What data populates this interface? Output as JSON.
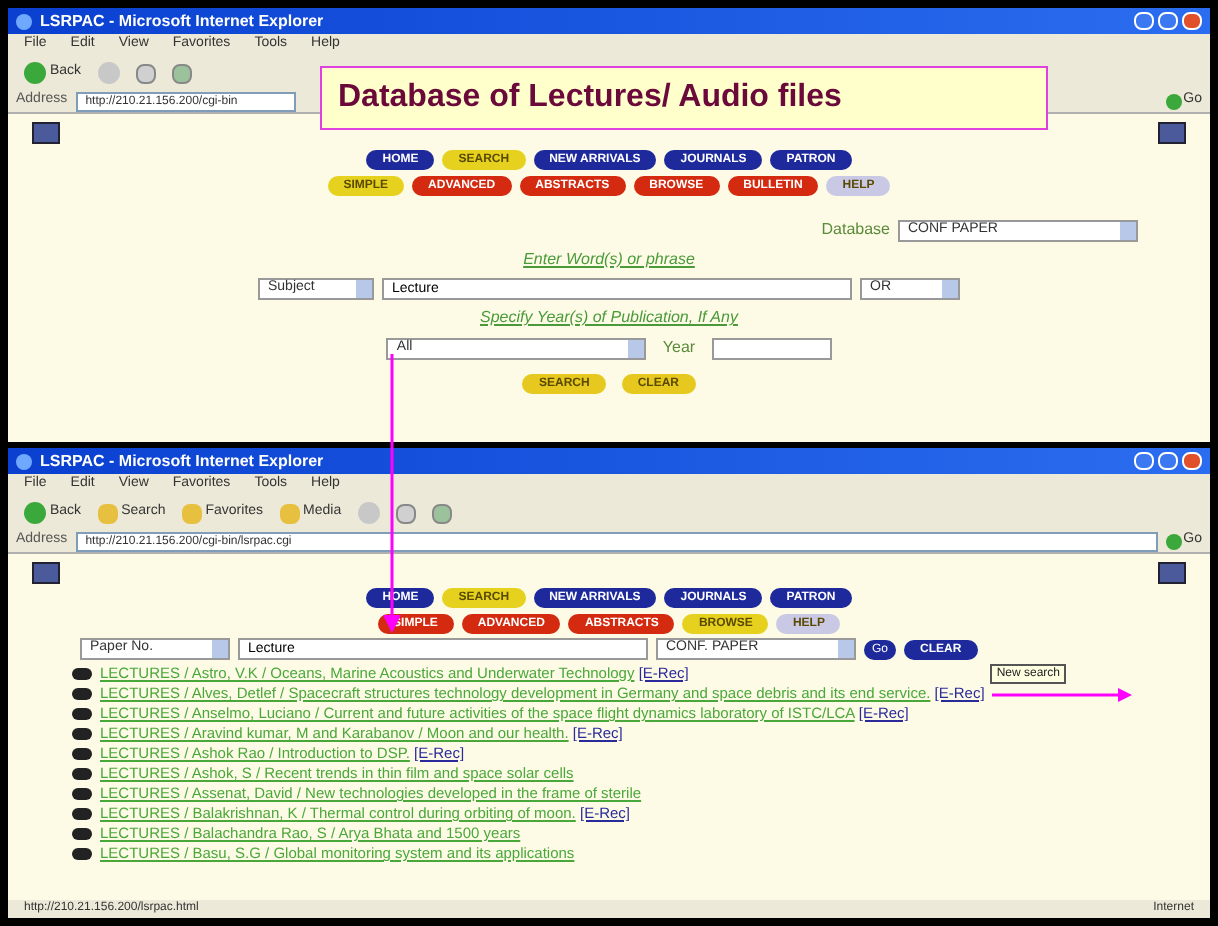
{
  "title_callout": "Database of Lectures/ Audio files",
  "windows": [
    {
      "title": "LSRPAC - Microsoft Internet Explorer",
      "menu": [
        "File",
        "Edit",
        "View",
        "Favorites",
        "Tools",
        "Help"
      ],
      "toolbar": [
        "Back"
      ],
      "address_label": "Address",
      "url": "http://210.21.156.200/cgi-bin",
      "go": "Go",
      "nav_rows": [
        [
          {
            "label": "HOME",
            "color": "#1e2a9c"
          },
          {
            "label": "SEARCH",
            "color": "#e6d21e"
          },
          {
            "label": "NEW ARRIVALS",
            "color": "#1e2a9c"
          },
          {
            "label": "JOURNALS",
            "color": "#1e2a9c"
          },
          {
            "label": "PATRON",
            "color": "#1e2a9c"
          }
        ],
        [
          {
            "label": "SIMPLE",
            "color": "#e6d21e"
          },
          {
            "label": "ADVANCED",
            "color": "#d42a10"
          },
          {
            "label": "ABSTRACTS",
            "color": "#d42a10"
          },
          {
            "label": "BROWSE",
            "color": "#d42a10"
          },
          {
            "label": "BULLETIN",
            "color": "#d42a10"
          },
          {
            "label": "HELP",
            "color": "#c9c9e6"
          }
        ]
      ],
      "form": {
        "database_label": "Database",
        "database": "CONF PAPER",
        "prompt": "Enter Word(s) or phrase",
        "field": "Subject",
        "query": "Lecture",
        "operator": "OR",
        "year_prompt": "Specify Year(s) of Publication, If Any",
        "year_range": "All",
        "year_label": "Year",
        "buttons": [
          "SEARCH",
          "CLEAR"
        ]
      }
    },
    {
      "title": "LSRPAC - Microsoft Internet Explorer",
      "menu": [
        "File",
        "Edit",
        "View",
        "Favorites",
        "Tools",
        "Help"
      ],
      "toolbar": [
        "Back",
        "Search",
        "Favorites",
        "Media"
      ],
      "address_label": "Address",
      "url": "http://210.21.156.200/cgi-bin/lsrpac.cgi",
      "go": "Go",
      "nav_rows": [
        [
          {
            "label": "HOME",
            "color": "#1e2a9c"
          },
          {
            "label": "SEARCH",
            "color": "#e6d21e"
          },
          {
            "label": "NEW ARRIVALS",
            "color": "#1e2a9c"
          },
          {
            "label": "JOURNALS",
            "color": "#1e2a9c"
          },
          {
            "label": "PATRON",
            "color": "#1e2a9c"
          }
        ],
        [
          {
            "label": "SIMPLE",
            "color": "#d42a10"
          },
          {
            "label": "ADVANCED",
            "color": "#d42a10"
          },
          {
            "label": "ABSTRACTS",
            "color": "#d42a10"
          },
          {
            "label": "BROWSE",
            "color": "#e6d21e"
          },
          {
            "label": "HELP",
            "color": "#c9c9e6"
          }
        ]
      ],
      "search_row": {
        "field": "Paper No.",
        "query": "Lecture",
        "database": "CONF. PAPER",
        "go": "Go",
        "clear": "CLEAR"
      },
      "tooltip": "New search",
      "results": [
        {
          "text": "LECTURES / Astro, V.K / Oceans, Marine Acoustics and Underwater Technology",
          "erec": "[E-Rec]"
        },
        {
          "text": "LECTURES / Alves, Detlef / Spacecraft structures technology development in Germany and space debris and its end service.",
          "erec": "[E-Rec]"
        },
        {
          "text": "LECTURES / Anselmo, Luciano / Current and future activities of the space flight dynamics laboratory of ISTC/LCA",
          "erec": "[E-Rec]"
        },
        {
          "text": "LECTURES / Aravind kumar, M and Karabanov / Moon and our health.",
          "erec": "[E-Rec]"
        },
        {
          "text": "LECTURES / Ashok Rao / Introduction to DSP.",
          "erec": "[E-Rec]"
        },
        {
          "text": "LECTURES / Ashok, S / Recent trends in thin film and space solar cells"
        },
        {
          "text": "LECTURES / Assenat, David / New technologies developed in the frame of sterile"
        },
        {
          "text": "LECTURES / Balakrishnan, K / Thermal control during orbiting of moon.",
          "erec": "[E-Rec]"
        },
        {
          "text": "LECTURES / Balachandra Rao, S / Arya Bhata and 1500 years"
        },
        {
          "text": "LECTURES / Basu, S.G / Global monitoring system and its applications"
        }
      ],
      "status": "http://210.21.156.200/lsrpac.html",
      "zone": "Internet"
    }
  ]
}
